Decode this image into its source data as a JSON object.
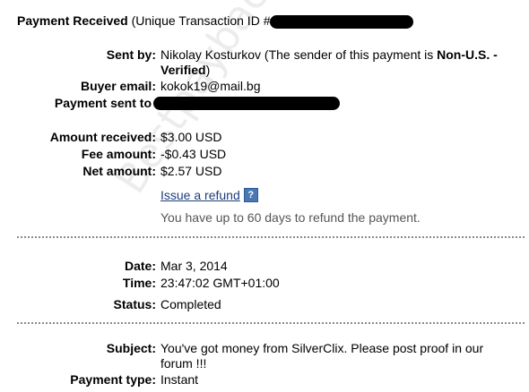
{
  "header": {
    "title_bold": "Payment Received",
    "title_rest": " (Unique Transaction ID #"
  },
  "sender": {
    "label": "Sent by:",
    "name": "Nikolay Kosturkov",
    "note_prefix": " (The sender of this payment is ",
    "note_bold": "Non-U.S. - Verified",
    "note_suffix": ")"
  },
  "buyer_email": {
    "label": "Buyer email:",
    "value": "kokok19@mail.bg"
  },
  "payment_sent_to": {
    "label": "Payment sent to"
  },
  "amounts": {
    "received": {
      "label": "Amount received:",
      "value": "$3.00 USD"
    },
    "fee": {
      "label": "Fee amount:",
      "value": "-$0.43 USD"
    },
    "net": {
      "label": "Net amount:",
      "value": "$2.57 USD"
    }
  },
  "refund": {
    "link_label": "Issue a refund",
    "help_icon_glyph": "?",
    "note": "You have up to 60 days to refund the payment."
  },
  "details": {
    "date": {
      "label": "Date:",
      "value": "Mar 3, 2014"
    },
    "time": {
      "label": "Time:",
      "value": "23:47:02 GMT+01:00"
    },
    "status": {
      "label": "Status:",
      "value": "Completed"
    }
  },
  "message": {
    "subject": {
      "label": "Subject:",
      "value": "You've got money from SilverClix. Please post proof in our forum !!!"
    },
    "payment_type": {
      "label": "Payment type:",
      "value": "Instant"
    }
  },
  "watermark": {
    "text": "Bestpayback4U.com"
  },
  "colors": {
    "link": "#1a3d7a",
    "note_grey": "#555555",
    "help_icon": "#4a78b4",
    "divider": "#8a8a8a"
  }
}
